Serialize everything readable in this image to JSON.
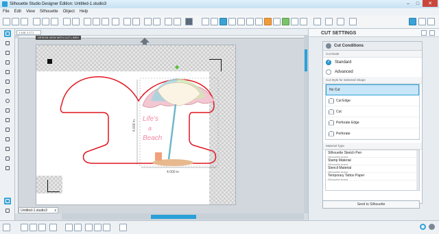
{
  "window": {
    "title": "Silhouette Studio Designer Edition: Untitled-1.studio3",
    "minimize": "–",
    "maximize": "□",
    "close": "✕"
  },
  "menu": [
    "File",
    "Edit",
    "View",
    "Silhouette",
    "Object",
    "Help"
  ],
  "canvas": {
    "design_view_label": "DESIGN VIEW WITH CUT LINES",
    "coordinate": "1.448, 4.171",
    "width_dim": "4.000 in",
    "height_dim": "4.000 in",
    "doc_tab": "Untitled-1.studio3",
    "doc_tab_close": "x"
  },
  "design_text": [
    "Life's",
    "a",
    "Beach"
  ],
  "panel": {
    "title": "CUT SETTINGS",
    "section": "Cut Conditions",
    "cut_mode_label": "Cut Mode",
    "modes": [
      {
        "label": "Standard",
        "selected": true
      },
      {
        "label": "Advanced",
        "selected": false
      }
    ],
    "cut_style_label": "Cut Style for Selected Shape",
    "styles": [
      {
        "label": "No Cut",
        "selected": true
      },
      {
        "label": "Cut Edge",
        "selected": false
      },
      {
        "label": "Cut",
        "selected": false
      },
      {
        "label": "Perforate Edge",
        "selected": false
      },
      {
        "label": "Perforate",
        "selected": false
      }
    ],
    "material_label": "Material Type",
    "materials": [
      {
        "name": "Silhouette Sketch Pen",
        "brand": "Silhouette brand"
      },
      {
        "name": "Stamp Material",
        "brand": "Silhouette brand"
      },
      {
        "name": "Stencil Material",
        "brand": "Silhouette brand"
      },
      {
        "name": "Temporary Tattoo Paper",
        "brand": "Silhouette brand"
      }
    ],
    "send_button": "Send to Silhouette"
  },
  "colors": {
    "accent": "#2aa0d8",
    "cut_line": "#e0141e"
  }
}
